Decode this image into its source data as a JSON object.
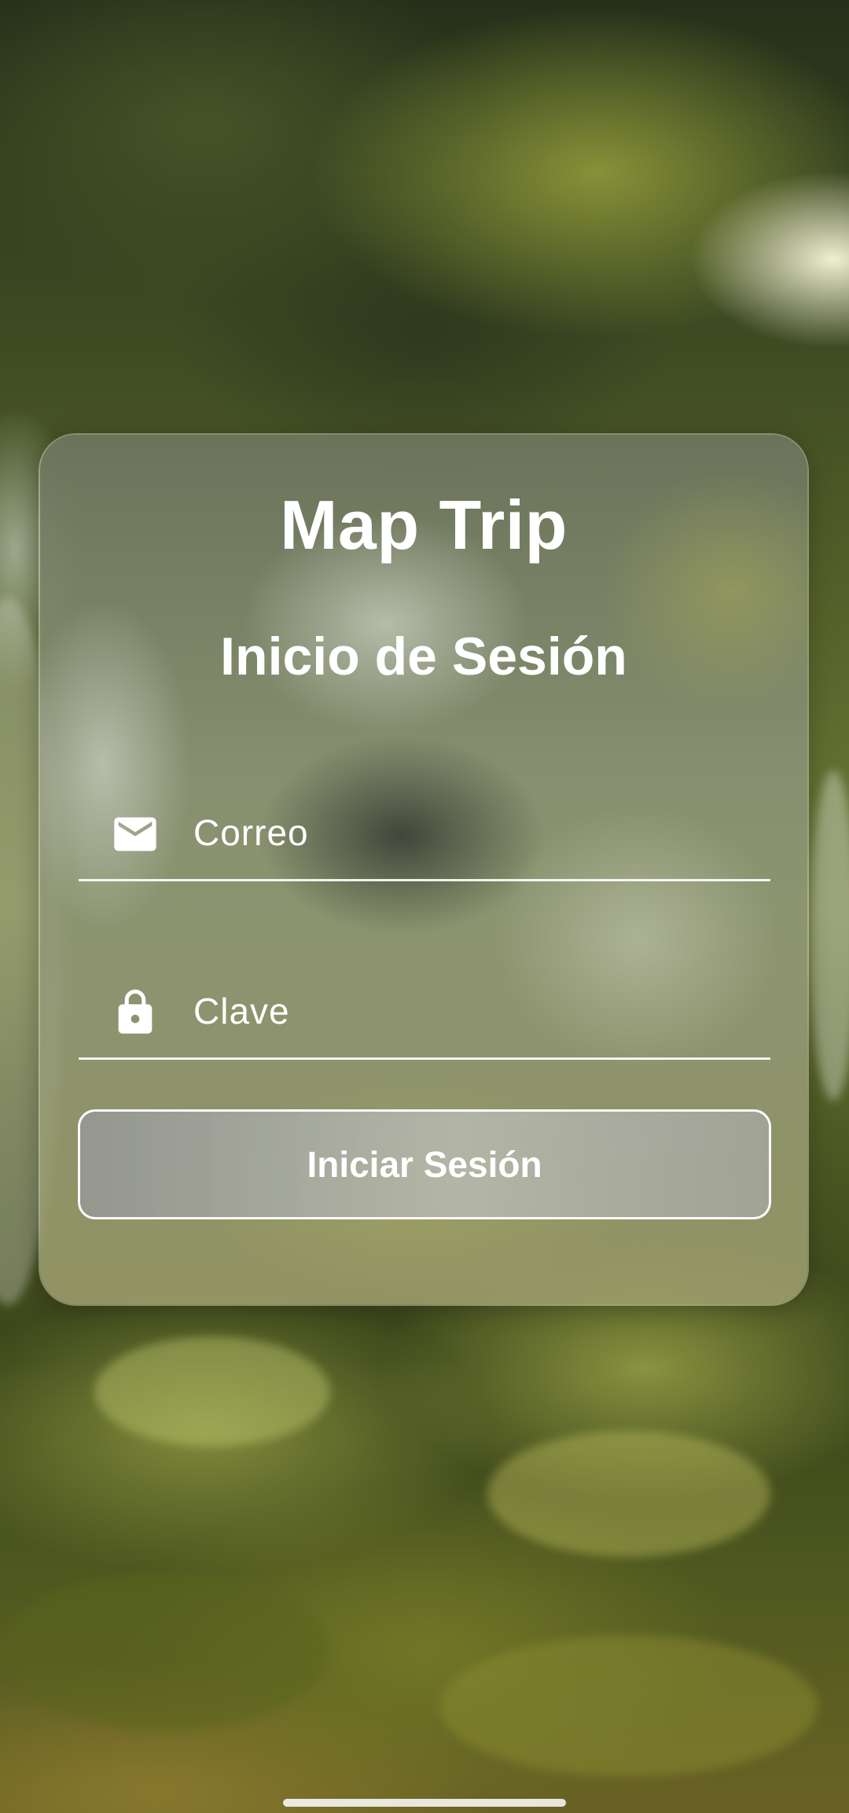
{
  "app": {
    "title": "Map Trip",
    "subtitle": "Inicio de Sesión"
  },
  "form": {
    "email": {
      "placeholder": "Correo",
      "icon": "mail-icon"
    },
    "password": {
      "placeholder": "Clave",
      "icon": "lock-icon"
    },
    "submit_label": "Iniciar Sesión"
  },
  "colors": {
    "text": "#ffffff",
    "underline": "#ffffff",
    "button_border": "#ffffff"
  }
}
